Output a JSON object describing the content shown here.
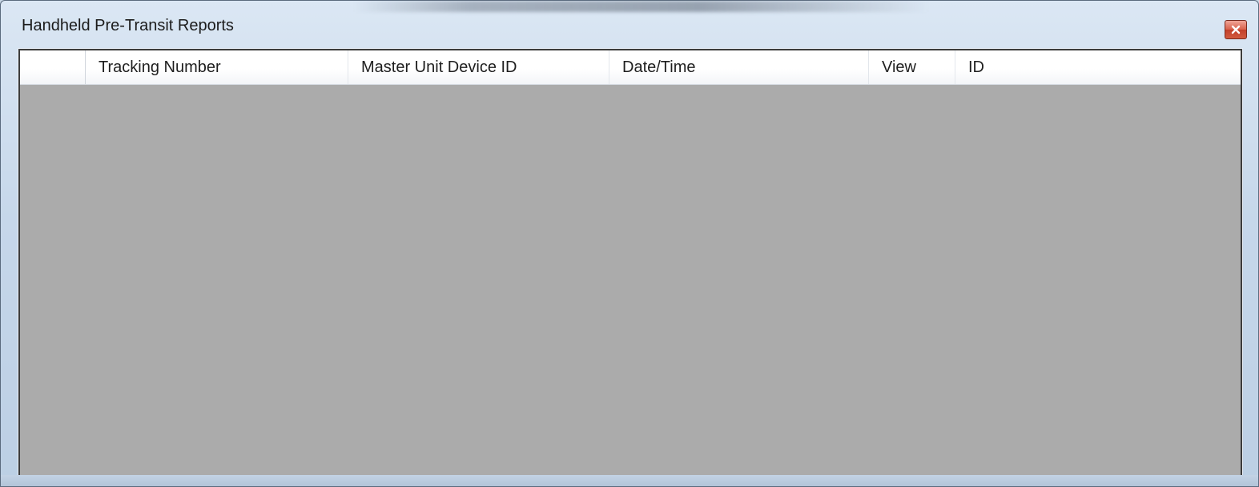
{
  "window": {
    "title": "Handheld Pre-Transit Reports",
    "close_icon": "close-icon"
  },
  "grid": {
    "columns": [
      {
        "label": ""
      },
      {
        "label": "Tracking Number"
      },
      {
        "label": "Master Unit Device ID"
      },
      {
        "label": "Date/Time"
      },
      {
        "label": "View"
      },
      {
        "label": "ID"
      }
    ],
    "rows": []
  },
  "colors": {
    "grid_background": "#ababab",
    "header_background": "#ffffff",
    "close_button": "#c7432c"
  }
}
